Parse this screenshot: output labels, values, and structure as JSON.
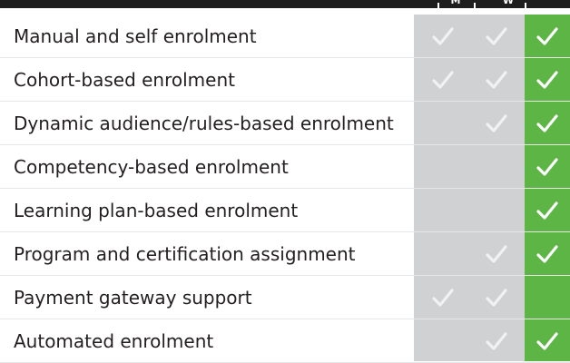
{
  "header": {
    "columns": [
      "M",
      "W"
    ]
  },
  "colors": {
    "header_bar": "#1e1e1e",
    "gray_columns": "#d0d1d3",
    "green_column": "#5cb545",
    "gray_check": "#f2f2f2",
    "green_check": "#ffffff",
    "text": "#231f20"
  },
  "rows": [
    {
      "label": "Manual and self enrolment",
      "col1": true,
      "col2": true,
      "col3": true
    },
    {
      "label": "Cohort-based enrolment",
      "col1": true,
      "col2": true,
      "col3": true
    },
    {
      "label": "Dynamic audience/rules-based enrolment",
      "col1": false,
      "col2": true,
      "col3": true
    },
    {
      "label": "Competency-based enrolment",
      "col1": false,
      "col2": false,
      "col3": true
    },
    {
      "label": "Learning plan-based enrolment",
      "col1": false,
      "col2": false,
      "col3": true
    },
    {
      "label": "Program and certification assignment",
      "col1": false,
      "col2": true,
      "col3": true
    },
    {
      "label": "Payment gateway support",
      "col1": true,
      "col2": true,
      "col3": false
    },
    {
      "label": "Automated enrolment",
      "col1": false,
      "col2": true,
      "col3": true
    }
  ]
}
